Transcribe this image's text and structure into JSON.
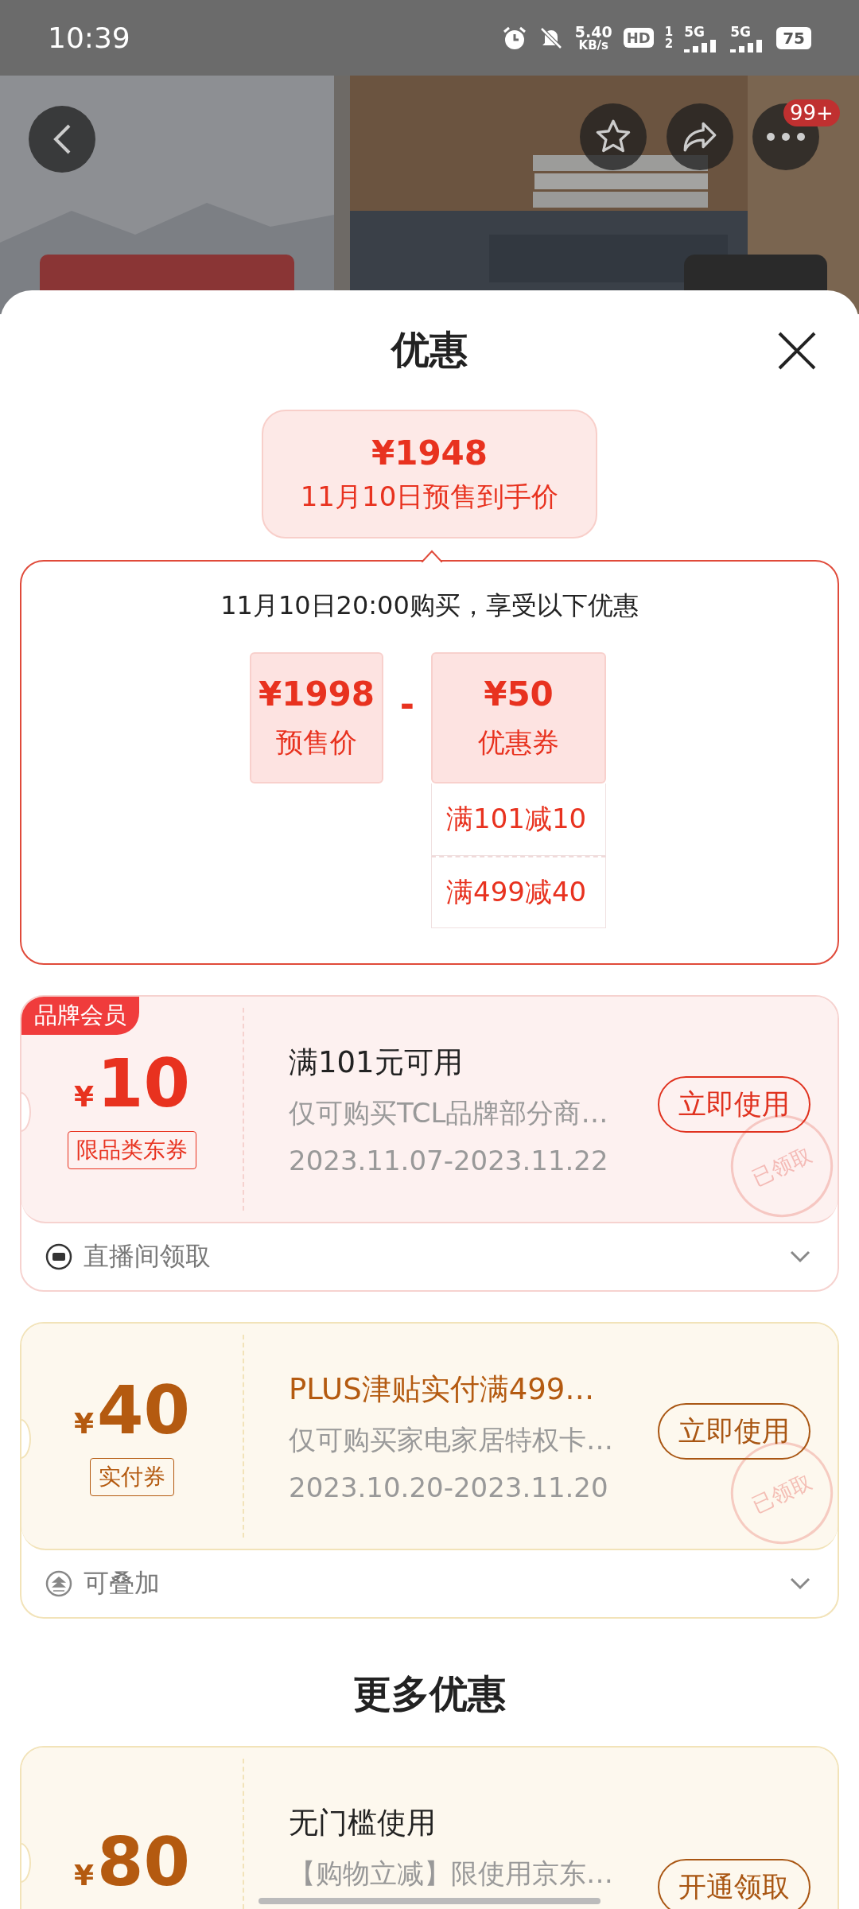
{
  "status_bar": {
    "time": "10:39",
    "net_speed": "5.40",
    "net_unit": "KB/s",
    "hd": "HD",
    "sim_1": "1",
    "sim_2": "2",
    "network_1": "5G",
    "network_2": "5G",
    "battery": "75"
  },
  "header": {
    "badge": "99+"
  },
  "sheet": {
    "title": "优惠"
  },
  "final_price": {
    "price": "¥1948",
    "label": "11月10日预售到手价"
  },
  "breakdown": {
    "note": "11月10日20:00购买，享受以下优惠",
    "presale": {
      "price": "¥1998",
      "label": "预售价"
    },
    "operator": "-",
    "coupon": {
      "price": "¥50",
      "label": "优惠券",
      "items": [
        "满101减10",
        "满499减40"
      ]
    }
  },
  "coupons": [
    {
      "kind": "brand",
      "tag": "品牌会员",
      "currency": "¥",
      "amount": "10",
      "type": "限品类东券",
      "title": "满101元可用",
      "highlight": false,
      "desc": "仅可购买TCL品牌部分商…",
      "dates": "2023.11.07-2023.11.22",
      "button": "立即使用",
      "stamp": "已领取",
      "footer": {
        "kind": "live",
        "label": "直播间领取"
      }
    },
    {
      "kind": "plus",
      "currency": "¥",
      "amount": "40",
      "type": "实付券",
      "title": "PLUS津贴实付满499…",
      "highlight": true,
      "desc": "仅可购买家电家居特权卡…",
      "dates": "2023.10.20-2023.11.20",
      "button": "立即使用",
      "stamp": "已领取",
      "footer": {
        "kind": "stack",
        "label": "可叠加"
      }
    }
  ],
  "more_title": "更多优惠",
  "more_coupons": [
    {
      "kind": "plus",
      "currency": "¥",
      "amount": "80",
      "title": "无门槛使用",
      "highlight": false,
      "desc": "【购物立减】限使用京东…",
      "button": "开通领取"
    }
  ]
}
